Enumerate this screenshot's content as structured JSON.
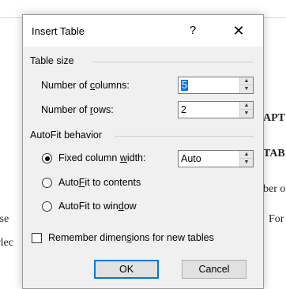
{
  "background_document": {
    "fragments": [
      "APT",
      "TAB",
      "ber o",
      "For",
      ".se",
      "rlec"
    ]
  },
  "dialog": {
    "title": "Insert Table",
    "help_label": "?",
    "close_label": "✕",
    "table_size": {
      "group_label": "Table size",
      "columns": {
        "label_pre": "Number of ",
        "label_ul": "c",
        "label_post": "olumns:",
        "value": "5"
      },
      "rows": {
        "label_pre": "Number of ",
        "label_ul": "r",
        "label_post": "ows:",
        "value": "2"
      }
    },
    "autofit": {
      "group_label": "AutoFit behavior",
      "fixed": {
        "label_pre": "Fixed column ",
        "label_ul": "w",
        "label_post": "idth:",
        "checked": true,
        "value": "Auto"
      },
      "contents": {
        "label_pre": "Auto",
        "label_ul": "F",
        "label_post": "it to contents",
        "checked": false
      },
      "window": {
        "label_pre": "AutoFit to win",
        "label_ul": "d",
        "label_post": "ow",
        "checked": false
      }
    },
    "remember": {
      "label_pre": "Remember dimen",
      "label_ul": "s",
      "label_post": "ions for new tables",
      "checked": false
    },
    "ok_label": "OK",
    "cancel_label": "Cancel"
  }
}
